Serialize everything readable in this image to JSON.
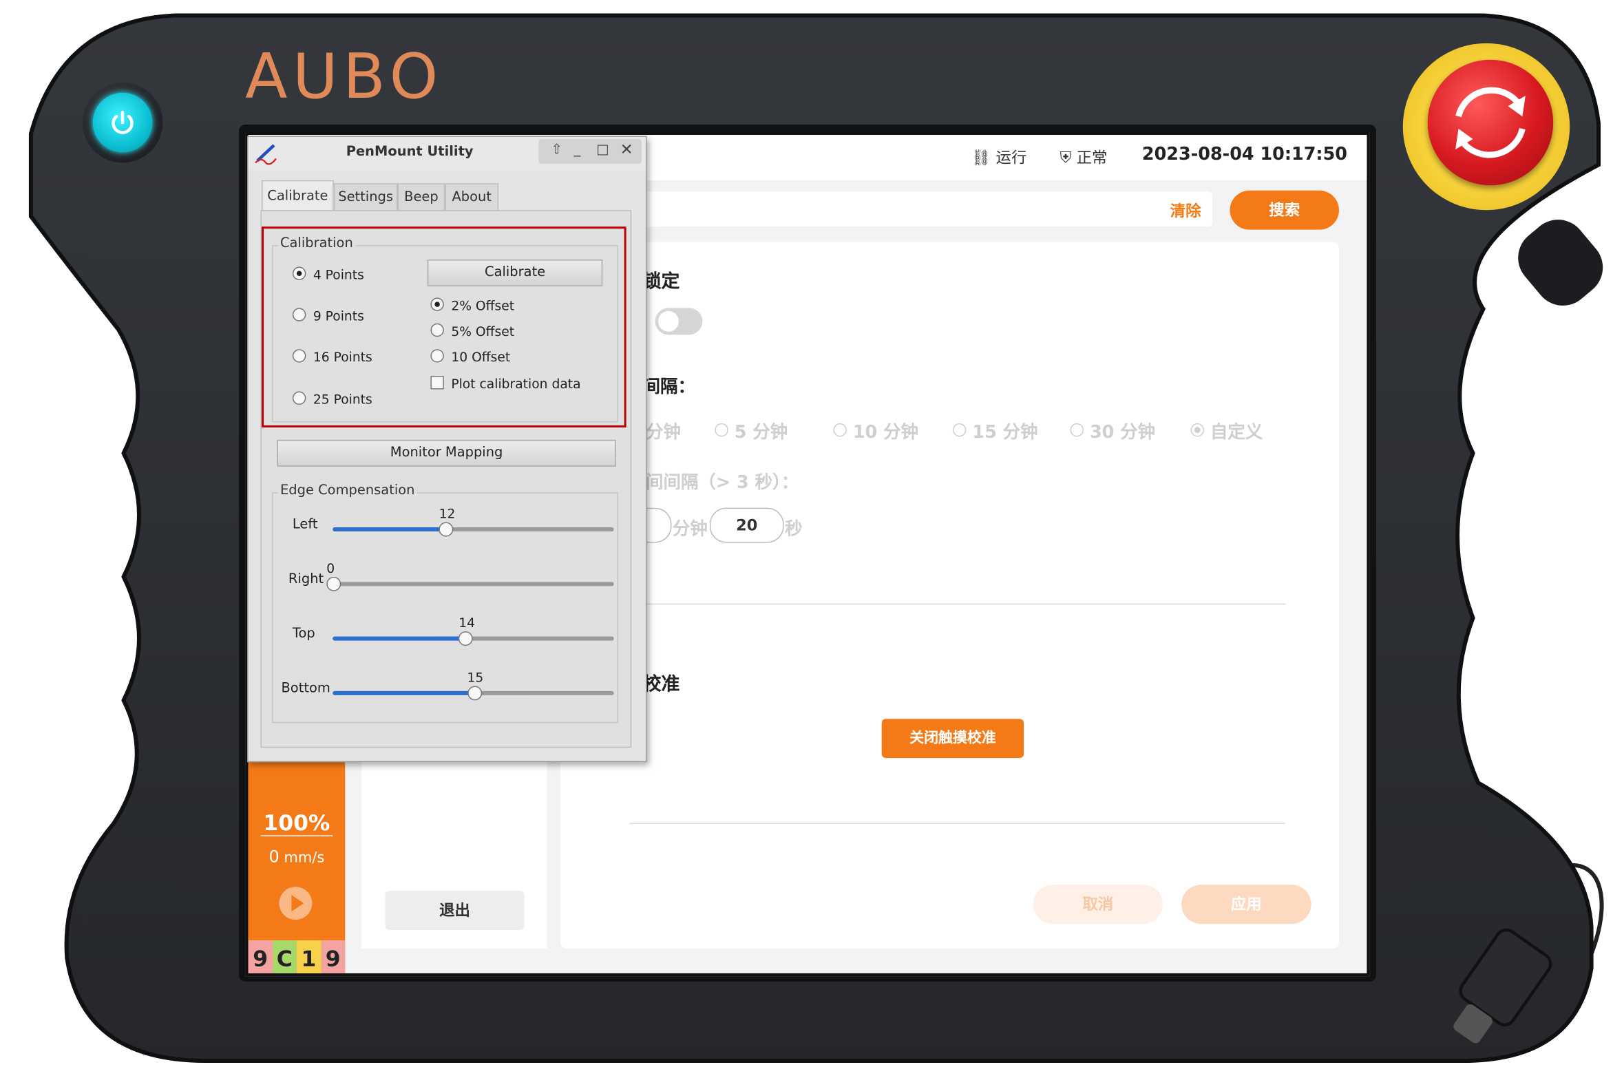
{
  "device": {
    "brand": "AUBO",
    "estop_label": "EMERGENCY STOP"
  },
  "topbar": {
    "run_label": "运行",
    "state_label": "正常",
    "datetime": "2023-08-04 10:17:50"
  },
  "search": {
    "clear_label": "清除",
    "search_label": "搜索"
  },
  "left_panel": {
    "speed_percent": "100%",
    "speed_value": "0",
    "speed_unit": "mm/s",
    "status_code": [
      "9",
      "C",
      "1",
      "9"
    ],
    "exit_label": "退出"
  },
  "main": {
    "section1_title_partial": "锁定",
    "interval_label_partial": "间隔：",
    "interval_options": [
      "分钟",
      "5 分钟",
      "10 分钟",
      "15 分钟",
      "30 分钟",
      "自定义"
    ],
    "interval_selected": "自定义",
    "custom_interval_label": "间间隔（> 3 秒）：",
    "minutes_value": "",
    "minutes_unit": "分钟",
    "seconds_value": "20",
    "seconds_unit": "秒",
    "section2_title_partial": "校准",
    "close_touch_cal_label": "关闭触摸校准",
    "cancel_label": "取消",
    "apply_label": "应用"
  },
  "penmount": {
    "title": "PenMount Utility",
    "tabs": [
      "Calibrate",
      "Settings",
      "Beep",
      "About"
    ],
    "active_tab": "Calibrate",
    "calibration_group": "Calibration",
    "points_options": [
      "4 Points",
      "9 Points",
      "16 Points",
      "25 Points"
    ],
    "points_selected": "4 Points",
    "calibrate_button": "Calibrate",
    "offset_options": [
      "2% Offset",
      "5% Offset",
      "10 Offset"
    ],
    "offset_selected": "2% Offset",
    "plot_checkbox": "Plot calibration data",
    "plot_checked": false,
    "monitor_mapping_button": "Monitor Mapping",
    "edge_group": "Edge Compensation",
    "edge": [
      {
        "label": "Left",
        "value": "12",
        "fraction": 0.4
      },
      {
        "label": "Right",
        "value": "0",
        "fraction": 0.0
      },
      {
        "label": "Top",
        "value": "14",
        "fraction": 0.47
      },
      {
        "label": "Bottom",
        "value": "15",
        "fraction": 0.5
      }
    ]
  },
  "colors": {
    "accent": "#f47a17",
    "pendant": "#2b2d31",
    "estop": "#d71920",
    "highlight_box": "#c00000"
  }
}
